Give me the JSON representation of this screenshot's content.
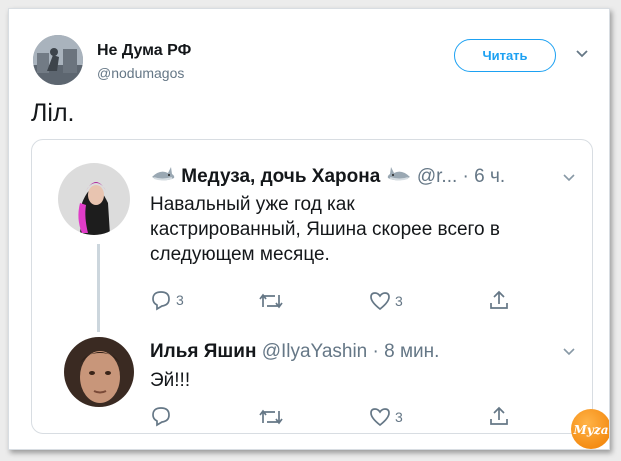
{
  "tweet": {
    "author_name": "Не Дума РФ",
    "author_handle": "@nodumagos",
    "follow_label": "Читать",
    "text": "Ліл."
  },
  "quoted": [
    {
      "name": "Медуза, дочь Харона",
      "meta": "@r... · 6 ч.",
      "text_lines": [
        "Навальный уже год как",
        "кастрированный, Яшина скорее всего в",
        "следующем месяце."
      ],
      "reply_count": "3",
      "like_count": "3"
    },
    {
      "name": "Илья Яшин",
      "meta": "@IlyaYashin · 8 мин.",
      "text_lines": [
        "Эй!!!"
      ],
      "reply_count": "",
      "like_count": "3"
    }
  ],
  "watermark": "Муzа",
  "icons": [
    "reply-icon",
    "retweet-icon",
    "like-icon",
    "share-icon",
    "chevron-down-icon",
    "shark-emoji-icon"
  ],
  "colors": {
    "accent": "#1da1f2",
    "muted": "#657786",
    "text": "#14171a"
  }
}
